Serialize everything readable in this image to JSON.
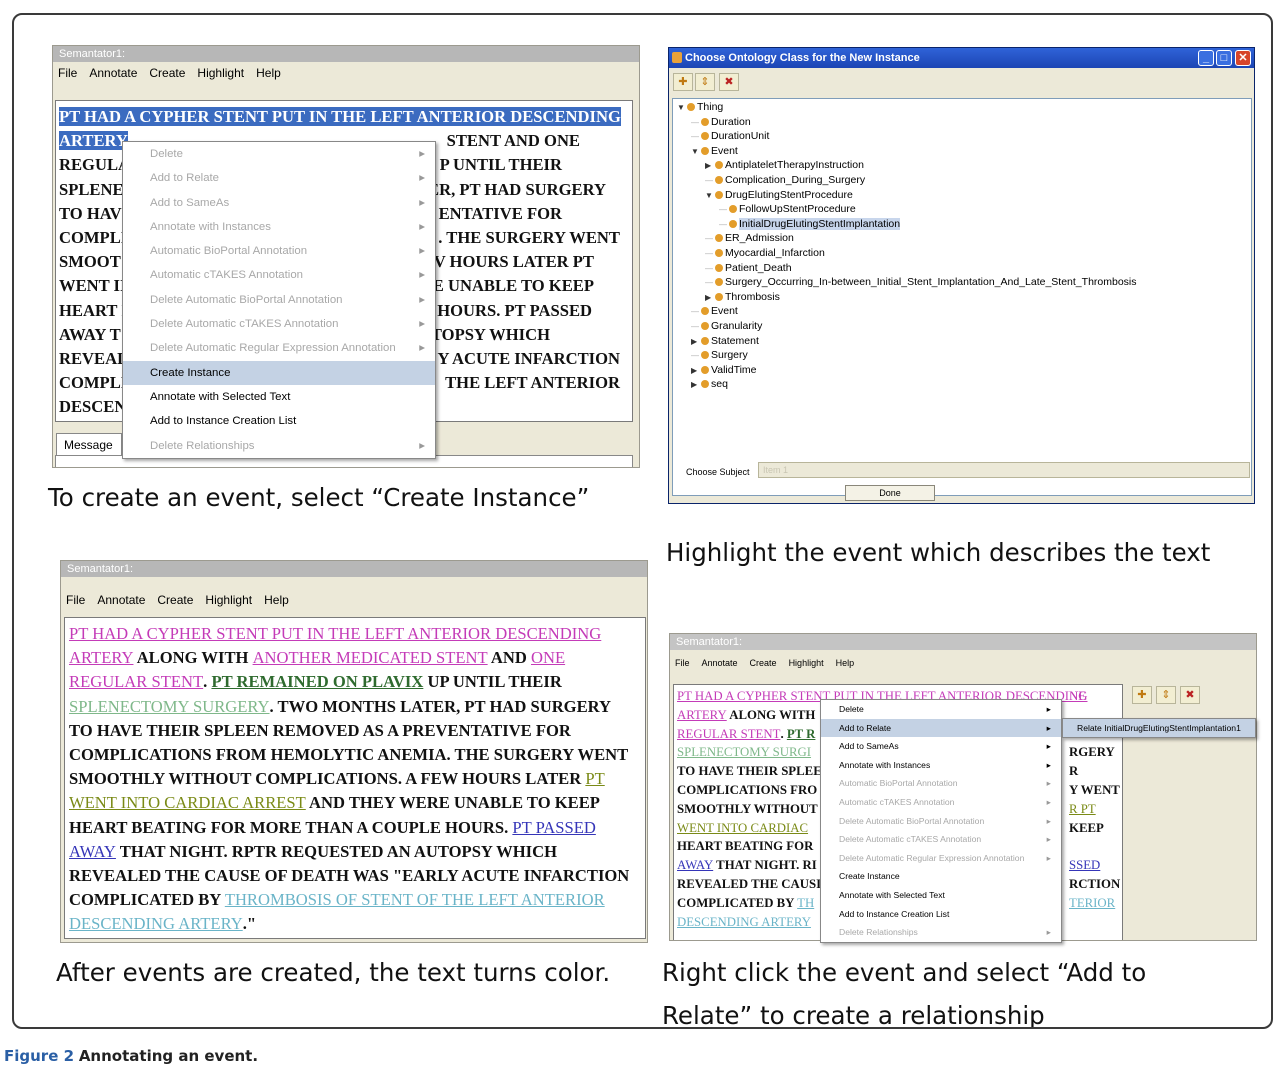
{
  "panel1": {
    "window_title": "Semantator1:",
    "menu": [
      "File",
      "Annotate",
      "Create",
      "Highlight",
      "Help"
    ],
    "text_lines": [
      [
        "PT HAD A CYPHER STENT PUT IN THE LEFT ANTERIOR DESCENDING",
        ""
      ],
      [
        "ARTERY",
        "STENT AND ONE"
      ],
      [
        "REGULA",
        "P UNTIL THEIR"
      ],
      [
        "SPLENEC",
        "ER, PT HAD SURGERY"
      ],
      [
        "TO HAV",
        "ENTATIVE FOR"
      ],
      [
        "COMPLI",
        ". THE SURGERY WENT"
      ],
      [
        "SMOOT",
        "V HOURS LATER PT"
      ],
      [
        "WENT II",
        "E UNABLE TO KEEP"
      ],
      [
        "HEART I",
        "HOURS. PT PASSED"
      ],
      [
        "AWAY T",
        "TOPSY WHICH"
      ],
      [
        "REVEAL",
        "Y ACUTE INFARCTION"
      ],
      [
        "COMPLI",
        "THE LEFT ANTERIOR"
      ],
      [
        "DESCEN",
        ""
      ]
    ],
    "context_menu": [
      {
        "label": "Delete",
        "enabled": false,
        "submenu": true
      },
      {
        "label": "Add to Relate",
        "enabled": false,
        "submenu": true
      },
      {
        "label": "Add to SameAs",
        "enabled": false,
        "submenu": true
      },
      {
        "label": "Annotate with Instances",
        "enabled": false,
        "submenu": true
      },
      {
        "label": "Automatic BioPortal Annotation",
        "enabled": false,
        "submenu": true
      },
      {
        "label": "Automatic cTAKES Annotation",
        "enabled": false,
        "submenu": true
      },
      {
        "label": "Delete Automatic BioPortal Annotation",
        "enabled": false,
        "submenu": true
      },
      {
        "label": "Delete Automatic cTAKES Annotation",
        "enabled": false,
        "submenu": true
      },
      {
        "label": "Delete Automatic Regular Expression Annotation",
        "enabled": false,
        "submenu": true
      },
      {
        "label": "Create Instance",
        "enabled": true,
        "submenu": false,
        "selected": true
      },
      {
        "label": "Annotate with Selected Text",
        "enabled": true,
        "submenu": false
      },
      {
        "label": "Add to Instance Creation List",
        "enabled": true,
        "submenu": false
      },
      {
        "label": "Delete Relationships",
        "enabled": false,
        "submenu": true
      }
    ],
    "message_tab": "Message",
    "caption": "To create an event, select “Create Instance”"
  },
  "panel2": {
    "window_title": "Choose Ontology Class for the New Instance",
    "tree": [
      {
        "label": "Thing",
        "depth": 0,
        "toggle": "open"
      },
      {
        "label": "Duration",
        "depth": 1,
        "toggle": "leaf"
      },
      {
        "label": "DurationUnit",
        "depth": 1,
        "toggle": "leaf"
      },
      {
        "label": "Event",
        "depth": 1,
        "toggle": "open"
      },
      {
        "label": "AntiplateletTherapyInstruction",
        "depth": 2,
        "toggle": "closed"
      },
      {
        "label": "Complication_During_Surgery",
        "depth": 2,
        "toggle": "leaf"
      },
      {
        "label": "DrugElutingStentProcedure",
        "depth": 2,
        "toggle": "open"
      },
      {
        "label": "FollowUpStentProcedure",
        "depth": 3,
        "toggle": "leaf"
      },
      {
        "label": "InitialDrugElutingStentImplantation",
        "depth": 3,
        "toggle": "leaf",
        "selected": true
      },
      {
        "label": "ER_Admission",
        "depth": 2,
        "toggle": "leaf"
      },
      {
        "label": "Myocardial_Infarction",
        "depth": 2,
        "toggle": "leaf"
      },
      {
        "label": "Patient_Death",
        "depth": 2,
        "toggle": "leaf"
      },
      {
        "label": "Surgery_Occurring_In-between_Initial_Stent_Implantation_And_Late_Stent_Thrombosis",
        "depth": 2,
        "toggle": "leaf"
      },
      {
        "label": "Thrombosis",
        "depth": 2,
        "toggle": "closed"
      },
      {
        "label": "Event",
        "depth": 1,
        "toggle": "leaf"
      },
      {
        "label": "Granularity",
        "depth": 1,
        "toggle": "leaf"
      },
      {
        "label": "Statement",
        "depth": 1,
        "toggle": "closed"
      },
      {
        "label": "Surgery",
        "depth": 1,
        "toggle": "leaf"
      },
      {
        "label": "ValidTime",
        "depth": 1,
        "toggle": "closed"
      },
      {
        "label": "seq",
        "depth": 1,
        "toggle": "closed"
      }
    ],
    "choose_subject_label": "Choose Subject",
    "choose_subject_value": "Item 1",
    "done_button": "Done",
    "caption": "Highlight the event which describes the text"
  },
  "panel3": {
    "window_title": "Semantator1:",
    "menu": [
      "File",
      "Annotate",
      "Create",
      "Highlight",
      "Help"
    ],
    "lines": [
      [
        {
          "t": "PT HAD A CYPHER STENT PUT IN THE LEFT ANTERIOR DESCENDING",
          "c": "mag"
        }
      ],
      [
        {
          "t": "ARTERY",
          "c": "mag"
        },
        {
          "t": " ALONG WITH ",
          "c": ""
        },
        {
          "t": "ANOTHER MEDICATED STENT",
          "c": "mag"
        },
        {
          "t": " AND ",
          "c": ""
        },
        {
          "t": "ONE",
          "c": "mag"
        }
      ],
      [
        {
          "t": "REGULAR STENT",
          "c": "mag"
        },
        {
          "t": ". ",
          "c": ""
        },
        {
          "t": "PT REMAINED ON PLAVIX",
          "c": "grn"
        },
        {
          "t": " UP UNTIL THEIR",
          "c": ""
        }
      ],
      [
        {
          "t": "SPLENECTOMY SURGERY",
          "c": "sgr"
        },
        {
          "t": ". TWO MONTHS LATER, PT HAD SURGERY",
          "c": ""
        }
      ],
      [
        {
          "t": "TO HAVE THEIR SPLEEN REMOVED AS A PREVENTATIVE FOR",
          "c": ""
        }
      ],
      [
        {
          "t": "COMPLICATIONS FROM HEMOLYTIC ANEMIA. THE SURGERY WENT",
          "c": ""
        }
      ],
      [
        {
          "t": "SMOOTHLY WITHOUT COMPLICATIONS. A FEW HOURS LATER ",
          "c": ""
        },
        {
          "t": "PT",
          "c": "olv"
        }
      ],
      [
        {
          "t": "WENT INTO CARDIAC ARREST",
          "c": "olv"
        },
        {
          "t": " AND THEY WERE UNABLE TO KEEP",
          "c": ""
        }
      ],
      [
        {
          "t": "HEART BEATING FOR MORE THAN A COUPLE HOURS. ",
          "c": ""
        },
        {
          "t": "PT PASSED",
          "c": "blu"
        }
      ],
      [
        {
          "t": "AWAY",
          "c": "blu"
        },
        {
          "t": " THAT NIGHT. RPTR REQUESTED AN AUTOPSY WHICH",
          "c": ""
        }
      ],
      [
        {
          "t": "REVEALED THE CAUSE OF DEATH WAS \"EARLY ACUTE INFARCTION",
          "c": ""
        }
      ],
      [
        {
          "t": "COMPLICATED BY ",
          "c": ""
        },
        {
          "t": "THROMBOSIS OF STENT OF THE LEFT ANTERIOR",
          "c": "cyn"
        }
      ],
      [
        {
          "t": "DESCENDING ARTERY",
          "c": "cyn"
        },
        {
          "t": ".\"",
          "c": ""
        }
      ]
    ],
    "caption": "After events are created, the text turns color."
  },
  "panel4": {
    "window_title": "Semantator1:",
    "menu": [
      "File",
      "Annotate",
      "Create",
      "Highlight",
      "Help"
    ],
    "lines": [
      [
        {
          "t": "PT HAD A CYPHER STENT PUT IN THE LEFT ANTERIOR DESCENDING",
          "c": "mag"
        }
      ],
      [
        {
          "t": "ARTERY",
          "c": "mag"
        },
        {
          "t": " ALONG WITH",
          "c": ""
        }
      ],
      [
        {
          "t": "REGULAR STENT",
          "c": "mag"
        },
        {
          "t": ". ",
          "c": ""
        },
        {
          "t": "PT R",
          "c": "grn"
        }
      ],
      [
        {
          "t": "SPLENECTOMY SURGI",
          "c": "sgr"
        }
      ],
      [
        {
          "t": "TO HAVE THEIR SPLEE",
          "c": ""
        }
      ],
      [
        {
          "t": "COMPLICATIONS FRO",
          "c": ""
        }
      ],
      [
        {
          "t": "SMOOTHLY WITHOUT",
          "c": ""
        }
      ],
      [
        {
          "t": "WENT INTO CARDIAC",
          "c": "olv"
        }
      ],
      [
        {
          "t": "HEART BEATING FOR",
          "c": ""
        }
      ],
      [
        {
          "t": "AWAY",
          "c": "blu"
        },
        {
          "t": " THAT NIGHT. RI",
          "c": ""
        }
      ],
      [
        {
          "t": "REVEALED THE CAUSI",
          "c": ""
        }
      ],
      [
        {
          "t": "COMPLICATED BY ",
          "c": ""
        },
        {
          "t": "TH",
          "c": "cyn"
        }
      ],
      [
        {
          "t": "DESCENDING ARTERY",
          "c": "cyn"
        }
      ]
    ],
    "right_fragments": [
      "NE",
      "RGERY",
      "R",
      "Y WENT",
      "R PT",
      "KEEP",
      "SSED",
      "",
      "RCTION",
      "TERIOR"
    ],
    "context_menu": [
      {
        "label": "Delete",
        "enabled": true,
        "submenu": true
      },
      {
        "label": "Add to Relate",
        "enabled": true,
        "submenu": true,
        "selected": true
      },
      {
        "label": "Add to SameAs",
        "enabled": true,
        "submenu": true
      },
      {
        "label": "Annotate with Instances",
        "enabled": true,
        "submenu": true
      },
      {
        "label": "Automatic BioPortal Annotation",
        "enabled": false,
        "submenu": true
      },
      {
        "label": "Automatic cTAKES Annotation",
        "enabled": false,
        "submenu": true
      },
      {
        "label": "Delete Automatic BioPortal Annotation",
        "enabled": false,
        "submenu": true
      },
      {
        "label": "Delete Automatic cTAKES Annotation",
        "enabled": false,
        "submenu": true
      },
      {
        "label": "Delete Automatic Regular Expression Annotation",
        "enabled": false,
        "submenu": true
      },
      {
        "label": "Create Instance",
        "enabled": true,
        "submenu": false
      },
      {
        "label": "Annotate with Selected Text",
        "enabled": true,
        "submenu": false
      },
      {
        "label": "Add to Instance Creation List",
        "enabled": true,
        "submenu": false
      },
      {
        "label": "Delete Relationships",
        "enabled": false,
        "submenu": true
      }
    ],
    "submenu_item": "Relate InitialDrugElutingStentImplantation1",
    "caption_line1": "Right click the event and select “Add to",
    "caption_line2": "Relate” to create a relationship"
  },
  "figure_caption": {
    "label": "Figure 2",
    "text": "Annotating an event."
  }
}
